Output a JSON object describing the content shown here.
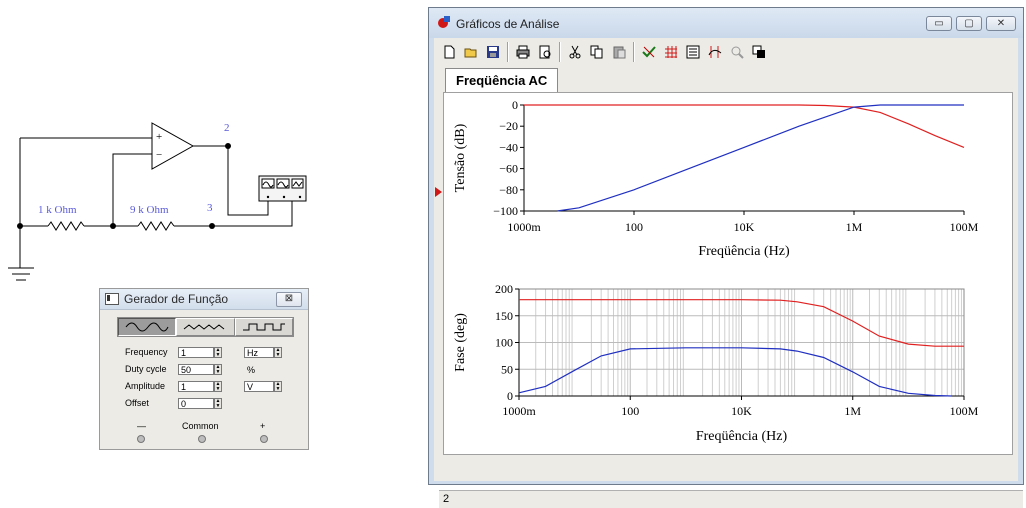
{
  "circuit": {
    "resistor1": "1 k Ohm",
    "resistor2": "9 k Ohm",
    "node2": "2",
    "node3": "3",
    "opamp_plus": "+",
    "opamp_minus": "−"
  },
  "function_generator": {
    "title": "Gerador de Função",
    "close": "⊠",
    "waveforms": [
      "sine",
      "triangle",
      "square"
    ],
    "selected_waveform": "sine",
    "fields": [
      {
        "label": "Frequency",
        "value": "1",
        "unit": "Hz"
      },
      {
        "label": "Duty cycle",
        "value": "50",
        "unit": "%"
      },
      {
        "label": "Amplitude",
        "value": "1",
        "unit": "V"
      },
      {
        "label": "Offset",
        "value": "0",
        "unit": ""
      }
    ],
    "terminals": {
      "minus": "—",
      "common": "Common",
      "plus": "+"
    }
  },
  "analysis_window": {
    "title": "Gráficos de Análise",
    "buttons": {
      "minimize": "▭",
      "maximize": "▢",
      "close": "✕"
    },
    "toolbar": [
      "new-icon",
      "open-icon",
      "save-icon",
      "print-icon",
      "print-preview-icon",
      "cut-icon",
      "copy-icon",
      "paste-icon",
      "properties-icon",
      "grid-icon",
      "legend-icon",
      "cursors-icon",
      "zoom-icon",
      "overlay-icon"
    ],
    "tab": "Freqüência AC",
    "status": "2",
    "colors": {
      "red": "#e02020",
      "blue": "#2030c0",
      "grid": "#cfcfcf"
    }
  },
  "chart_data": [
    {
      "type": "line",
      "xlabel": "Freqüência (Hz)",
      "ylabel": "Tensão (dB)",
      "x_scale": "log",
      "xlim": [
        1,
        100000000
      ],
      "x_ticks": [
        1,
        100,
        10000,
        1000000,
        100000000
      ],
      "x_tick_labels": [
        "1000m",
        "100",
        "10K",
        "1M",
        "100M"
      ],
      "ylim": [
        -100,
        0
      ],
      "y_ticks": [
        0,
        -20,
        -40,
        -60,
        -80,
        -100
      ],
      "grid": false,
      "series": [
        {
          "color": "#e02020",
          "x": [
            1,
            10,
            100,
            1000,
            10000,
            100000,
            300000,
            1000000,
            3000000,
            10000000,
            30000000,
            100000000
          ],
          "y": [
            0,
            0,
            0,
            0,
            0,
            0,
            -0.5,
            -2,
            -7,
            -18,
            -29,
            -40
          ]
        },
        {
          "color": "#2030c0",
          "x": [
            4,
            10,
            100,
            1000,
            10000,
            100000,
            1000000,
            3000000,
            10000000,
            100000000
          ],
          "y": [
            -100,
            -97,
            -80,
            -60,
            -40,
            -20,
            -2,
            0,
            0,
            0
          ]
        }
      ]
    },
    {
      "type": "line",
      "xlabel": "Freqüência (Hz)",
      "ylabel": "Fase (deg)",
      "x_scale": "log",
      "xlim": [
        1,
        100000000
      ],
      "x_ticks": [
        1,
        100,
        10000,
        1000000,
        100000000
      ],
      "x_tick_labels": [
        "1000m",
        "100",
        "10K",
        "1M",
        "100M"
      ],
      "ylim": [
        0,
        200
      ],
      "y_ticks": [
        0,
        50,
        100,
        150,
        200
      ],
      "grid": true,
      "series": [
        {
          "color": "#e02020",
          "x": [
            1,
            10,
            100,
            1000,
            10000,
            50000,
            100000,
            300000,
            1000000,
            3000000,
            10000000,
            30000000,
            100000000
          ],
          "y": [
            180,
            180,
            180,
            180,
            180,
            179,
            176,
            167,
            140,
            112,
            97,
            93,
            93
          ]
        },
        {
          "color": "#2030c0",
          "x": [
            1,
            3,
            10,
            30,
            100,
            1000,
            10000,
            50000,
            100000,
            300000,
            1000000,
            3000000,
            10000000,
            30000000,
            60000000
          ],
          "y": [
            6,
            18,
            48,
            75,
            88,
            90,
            90,
            88,
            84,
            72,
            45,
            18,
            5,
            1,
            0
          ]
        }
      ]
    }
  ]
}
